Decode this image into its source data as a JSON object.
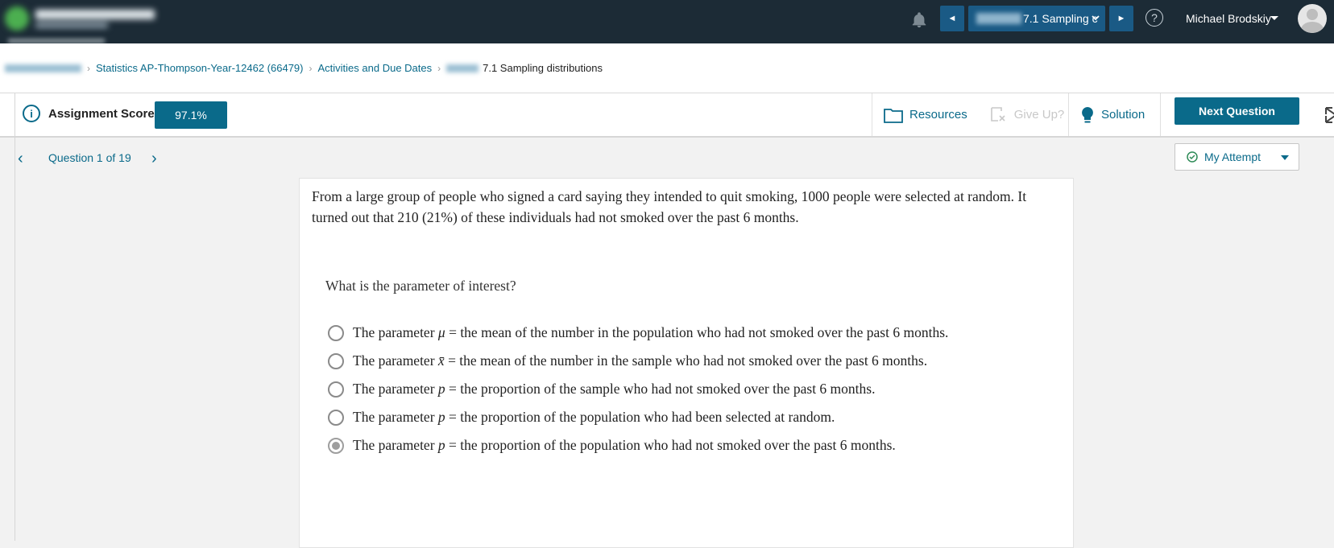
{
  "topbar": {
    "assignment_select": "7.1 Sampling c",
    "prev_symbol": "◄",
    "next_symbol": "►",
    "help_symbol": "?",
    "user_name": "Michael Brodskiy"
  },
  "breadcrumb": {
    "course": "Statistics AP-Thompson-Year-12462 (66479)",
    "activities": "Activities and Due Dates",
    "current": "7.1 Sampling distributions"
  },
  "score": {
    "label": "Assignment Score:",
    "value": "97.1%"
  },
  "tools": {
    "resources": "Resources",
    "give_up": "Give Up?",
    "solution": "Solution",
    "next_question": "Next Question"
  },
  "question_nav": {
    "label": "Question 1 of 19",
    "attempt": "My Attempt"
  },
  "question": {
    "stem": "From a large group of people who signed a card saying they intended to quit smoking, 1000 people were selected at random. It turned out that 210 (21%) of these individuals had not smoked over the past 6 months.",
    "prompt": "What is the parameter of interest?",
    "options": [
      {
        "prefix": "The parameter ",
        "symbol": "μ",
        "suffix": " = the mean of the number in the population who had not smoked over the past 6 months.",
        "selected": false
      },
      {
        "prefix": "The parameter ",
        "symbol": "x̄",
        "suffix": " = the mean of the number in the sample who had not smoked over the past 6 months.",
        "selected": false
      },
      {
        "prefix": "The parameter ",
        "symbol": "p",
        "suffix": " = the proportion of the sample who had not smoked over the past 6 months.",
        "selected": false
      },
      {
        "prefix": "The parameter ",
        "symbol": "p",
        "suffix": " = the proportion of the population who had been selected at random.",
        "selected": false
      },
      {
        "prefix": "The parameter ",
        "symbol": "p",
        "suffix": " = the proportion of the population who had not smoked over the past 6 months.",
        "selected": true
      }
    ]
  },
  "colors": {
    "topbar": "#1c2b36",
    "accent": "#0a6a8a",
    "nav_button": "#1a5a85"
  },
  "icons": [
    "bell-icon",
    "help-icon",
    "info-icon",
    "folder-icon",
    "give-up-icon",
    "lightbulb-icon",
    "check-circle-icon",
    "expand-icon"
  ]
}
